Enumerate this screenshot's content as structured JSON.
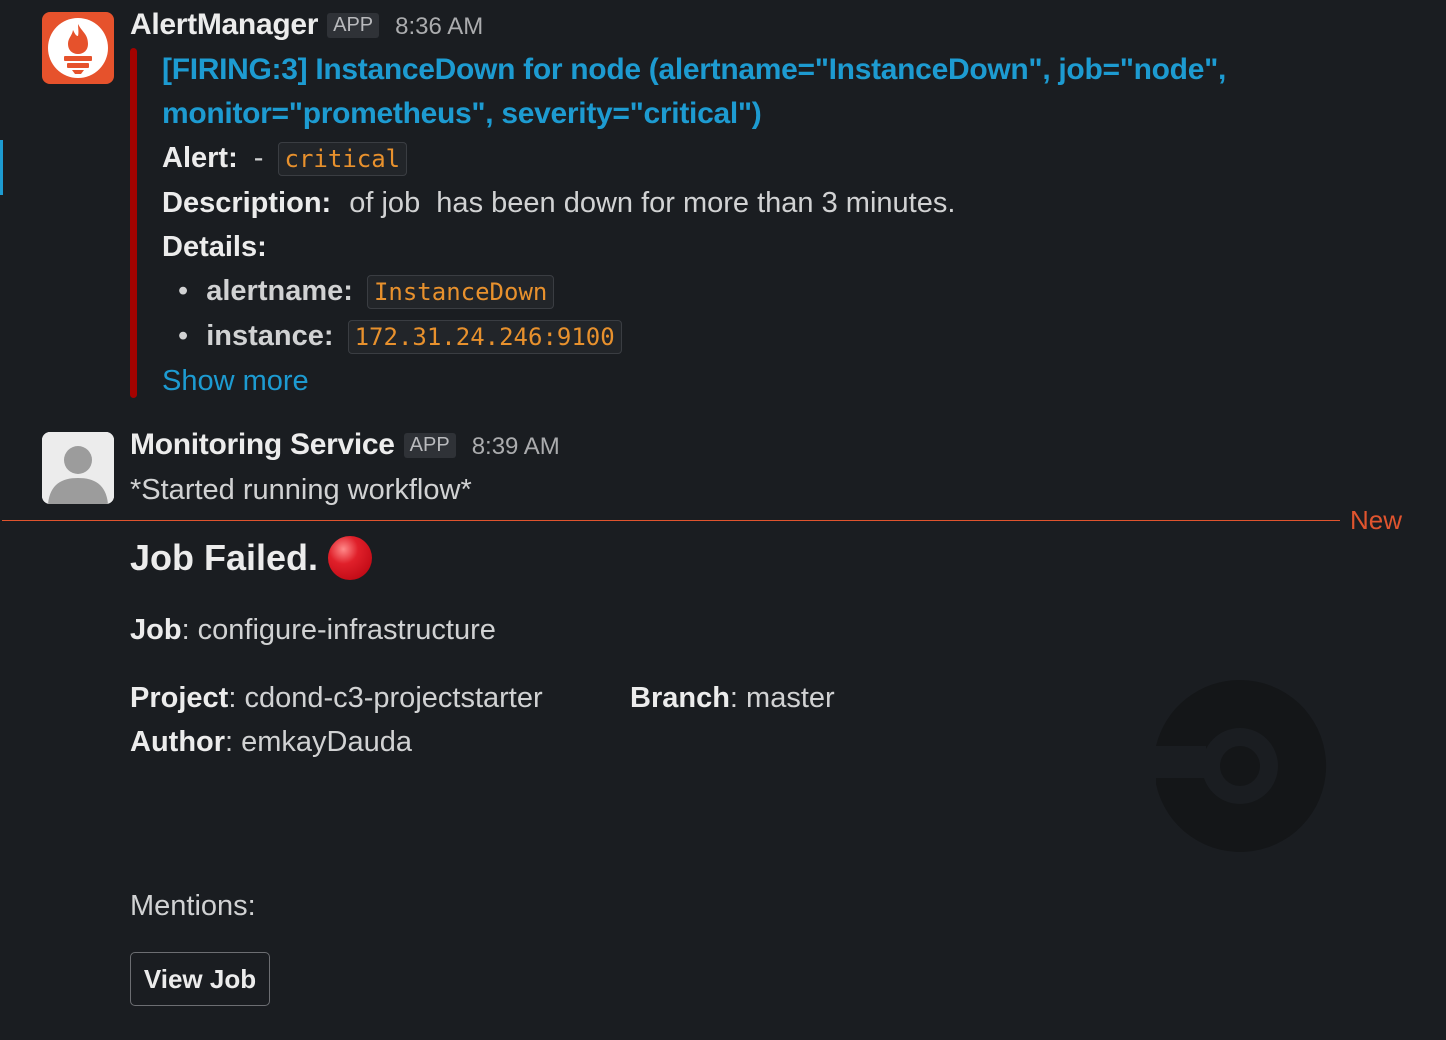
{
  "messages": {
    "alert": {
      "sender": "AlertManager",
      "badge": "APP",
      "time": "8:36 AM",
      "title": "[FIRING:3] InstanceDown for node (alertname=\"InstanceDown\", job=\"node\", monitor=\"prometheus\", severity=\"critical\")",
      "alert_label": "Alert:",
      "alert_sep": "-",
      "alert_severity": "critical",
      "description_label": "Description:",
      "description_text": "of job  has been down for more than 3 minutes.",
      "details_label": "Details:",
      "details": [
        {
          "key": "alertname:",
          "value": "InstanceDown"
        },
        {
          "key": "instance:",
          "value": "172.31.24.246:9100"
        }
      ],
      "show_more": "Show more",
      "attachment_color": "#a30200",
      "avatar_icon": "prometheus-logo-icon"
    },
    "monitoring": {
      "sender": "Monitoring Service",
      "badge": "APP",
      "time": "8:39 AM",
      "text": "*Started running workflow*",
      "avatar_icon": "default-user-icon"
    }
  },
  "divider": {
    "label": "New",
    "color": "#e0542e"
  },
  "job_card": {
    "title": "Job Failed.",
    "status_icon": "red-circle-icon",
    "job_label": "Job",
    "job_value": ": configure-infrastructure",
    "project_label": "Project",
    "project_value": ": cdond-c3-projectstarter",
    "branch_label": "Branch",
    "branch_value": ": master",
    "author_label": "Author",
    "author_value": ": emkayDauda",
    "mentions_label": "Mentions:",
    "button_label": "View Job",
    "logo_icon": "circleci-logo-icon"
  }
}
